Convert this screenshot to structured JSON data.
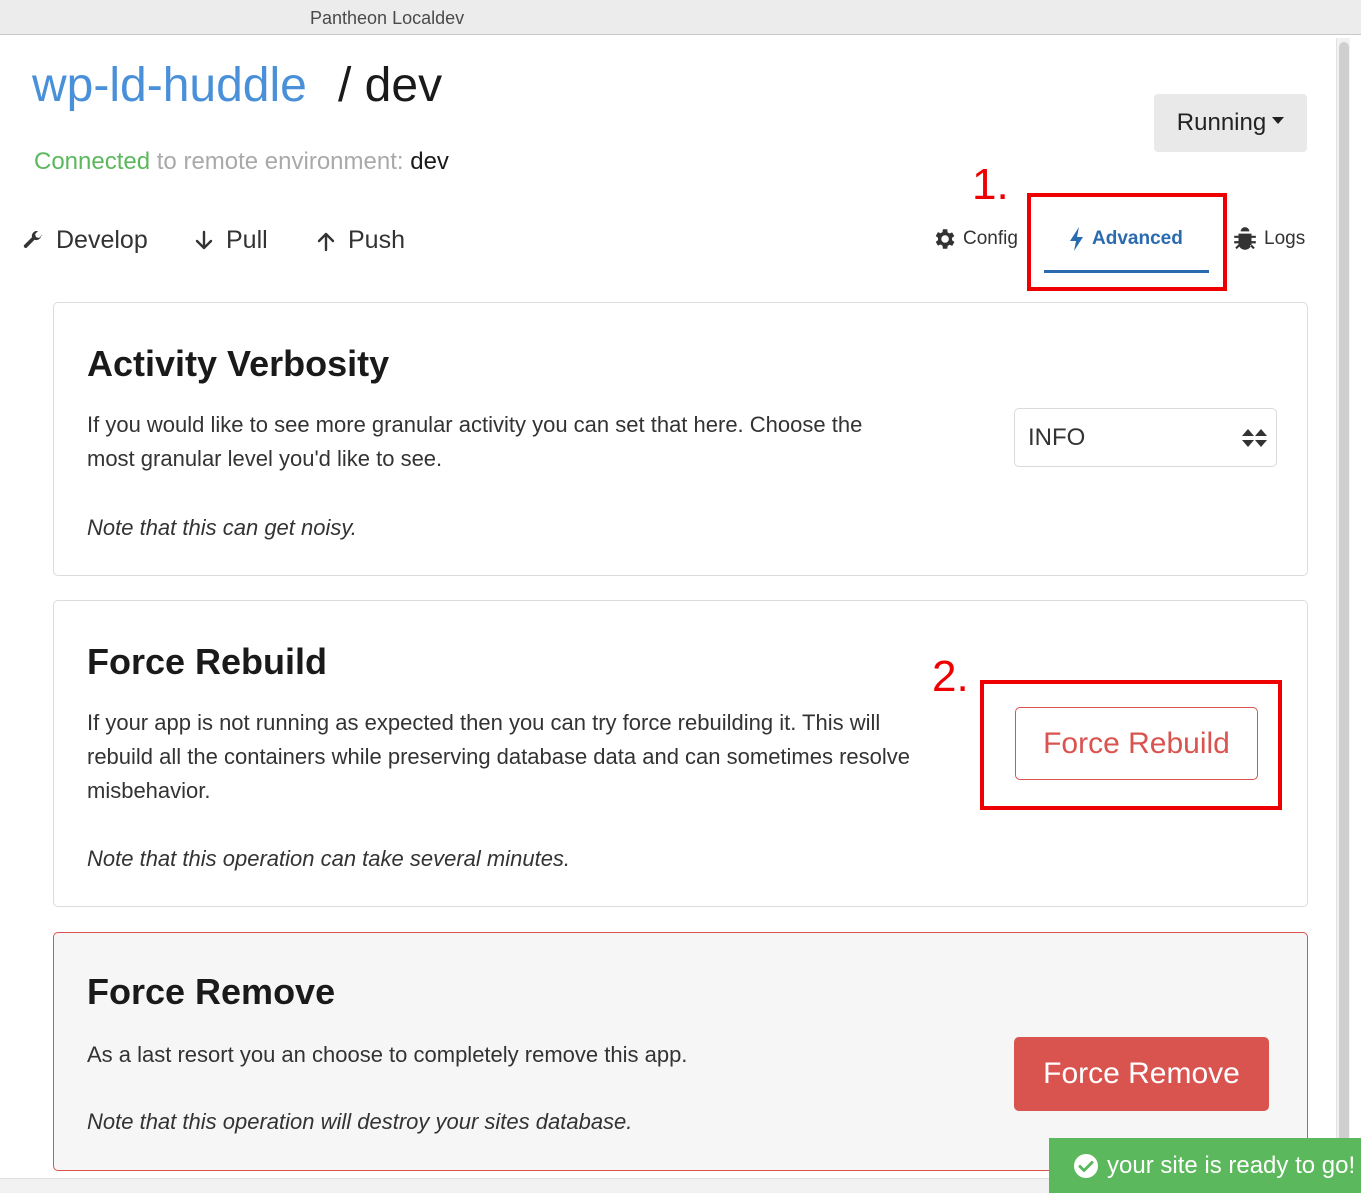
{
  "window": {
    "title": "Pantheon Localdev"
  },
  "header": {
    "app_name": "wp-ld-huddle",
    "env_name": "/ dev",
    "status_connected": "Connected",
    "status_text": " to remote environment: ",
    "status_env": "dev",
    "state_button": "Running"
  },
  "nav": {
    "develop": "Develop",
    "pull": "Pull",
    "push": "Push",
    "config": "Config",
    "advanced": "Advanced",
    "logs": "Logs"
  },
  "annotations": {
    "first": "1.",
    "second": "2."
  },
  "cards": {
    "verbosity": {
      "title": "Activity Verbosity",
      "desc_line1": "If you would like to see more granular activity you can set that here. Choose the",
      "desc_line2": "most granular level you'd like to see.",
      "note": "Note that this can get noisy.",
      "selected": "INFO"
    },
    "rebuild": {
      "title": "Force Rebuild",
      "desc_line1": "If your app is not running as expected then you can try force rebuilding it. This will",
      "desc_line2": "rebuild all the containers while preserving database data and can sometimes resolve",
      "desc_line3": "misbehavior.",
      "note": "Note that this operation can take several minutes.",
      "button": "Force Rebuild"
    },
    "remove": {
      "title": "Force Remove",
      "desc": "As a last resort you an choose to completely remove this app.",
      "note": "Note that this operation will destroy your sites database.",
      "button": "Force Remove"
    }
  },
  "toast": {
    "text": "your site is ready to go!"
  },
  "colors": {
    "accent": "#2a6bb0",
    "app_name": "#4a90d9",
    "success": "#5cb85c",
    "danger": "#d9534f",
    "annotation": "#ee0000"
  }
}
